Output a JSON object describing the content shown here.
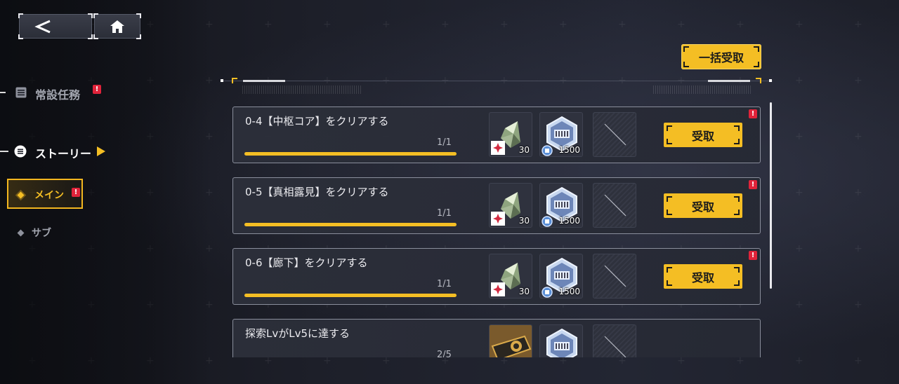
{
  "nav": {
    "back_icon": "chevron-left-icon",
    "home_icon": "home-icon"
  },
  "sidebar": {
    "regular": {
      "label": "常設任務",
      "icon": "list-icon",
      "alert": "!"
    },
    "story": {
      "label": "ストーリー",
      "icon": "menu-circle-icon"
    },
    "sub_items": [
      {
        "label": "メイン",
        "selected": true,
        "alert": "!"
      },
      {
        "label": "サブ",
        "selected": false
      }
    ]
  },
  "header": {
    "bulk_claim_label": "一括受取"
  },
  "tasks": [
    {
      "title": "0-4【中枢コア】をクリアする",
      "progress_text": "1/1",
      "progress": 1.0,
      "rewards": [
        {
          "icon": "crystal-shard-icon",
          "count": "30"
        },
        {
          "icon": "ticket-token-icon",
          "count": "1500"
        },
        {
          "icon": "empty-slot-icon",
          "count": ""
        }
      ],
      "claim_label": "受取",
      "alert": "!"
    },
    {
      "title": "0-5【真相露見】をクリアする",
      "progress_text": "1/1",
      "progress": 1.0,
      "rewards": [
        {
          "icon": "crystal-shard-icon",
          "count": "30"
        },
        {
          "icon": "ticket-token-icon",
          "count": "1500"
        },
        {
          "icon": "empty-slot-icon",
          "count": ""
        }
      ],
      "claim_label": "受取",
      "alert": "!"
    },
    {
      "title": "0-6【廊下】をクリアする",
      "progress_text": "1/1",
      "progress": 1.0,
      "rewards": [
        {
          "icon": "crystal-shard-icon",
          "count": "30"
        },
        {
          "icon": "ticket-token-icon",
          "count": "1500"
        },
        {
          "icon": "empty-slot-icon",
          "count": ""
        }
      ],
      "claim_label": "受取",
      "alert": "!"
    },
    {
      "title": "探索LvがLv5に達する",
      "progress_text": "2/5",
      "progress": 0.4,
      "rewards": [
        {
          "icon": "badge-card-icon",
          "count": ""
        },
        {
          "icon": "ticket-token-icon",
          "count": ""
        },
        {
          "icon": "empty-slot-icon",
          "count": ""
        }
      ],
      "claim_label": "",
      "alert": ""
    }
  ],
  "colors": {
    "accent": "#f4be24",
    "alert": "#e0233a",
    "panel": "#2c2f3a"
  }
}
